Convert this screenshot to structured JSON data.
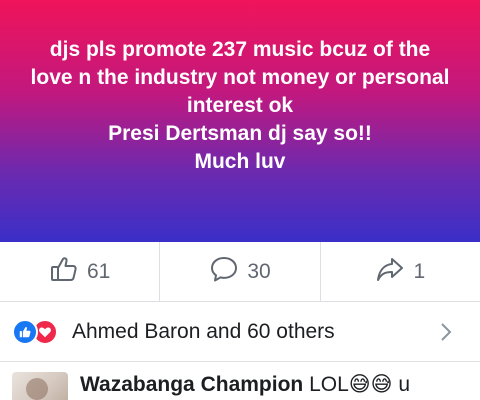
{
  "post": {
    "status_text": "djs pls  promote 237 music bcuz of the\nlove n the industry not money or personal\ninterest  ok\nPresi Dertsman dj say so!!\nMuch luv",
    "background_colors": [
      "#f0145a",
      "#c2187e",
      "#6a2ab0",
      "#3a2fc8"
    ]
  },
  "actions": {
    "like": {
      "icon": "thumbs-up-icon",
      "count": "61"
    },
    "comment": {
      "icon": "speech-bubble-icon",
      "count": "30"
    },
    "share": {
      "icon": "share-arrow-icon",
      "count": "1"
    }
  },
  "reactions": {
    "icons": [
      "like-reaction-icon",
      "love-reaction-icon"
    ],
    "summary": "Ahmed Baron and 60 others"
  },
  "comment": {
    "author": "Wazabanga Champion",
    "text": "LOL😅😅 u"
  },
  "colors": {
    "like_blue": "#1877f2",
    "love_red": "#f02849",
    "muted_text": "#606770"
  }
}
